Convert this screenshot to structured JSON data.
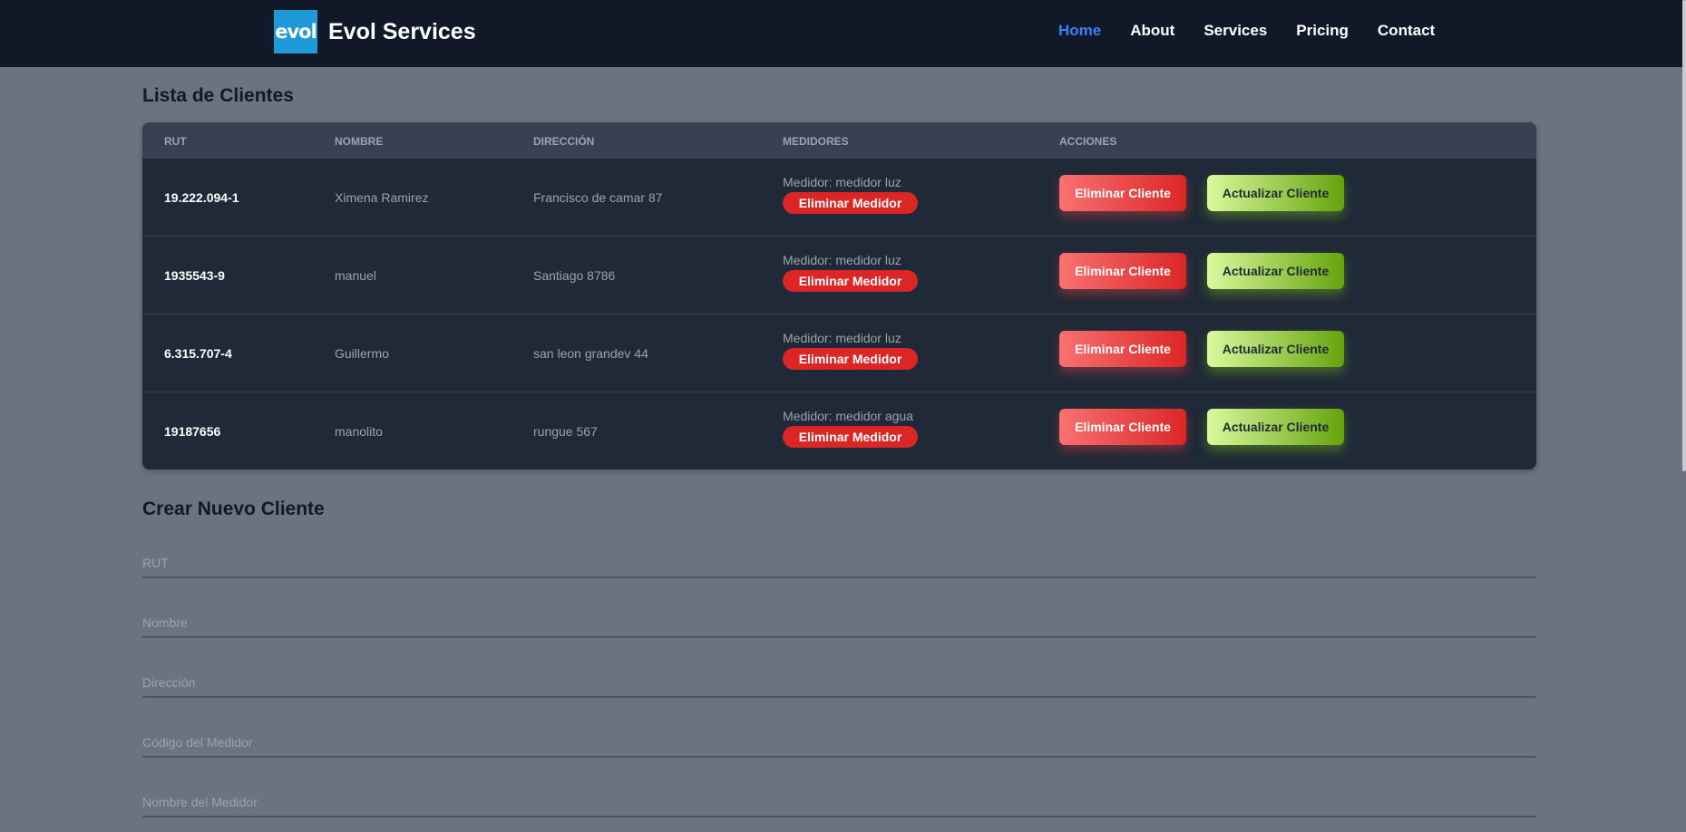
{
  "navbar": {
    "logo_text": "evol",
    "brand": "Evol Services",
    "links": [
      {
        "label": "Home",
        "active": true
      },
      {
        "label": "About"
      },
      {
        "label": "Services"
      },
      {
        "label": "Pricing"
      },
      {
        "label": "Contact"
      }
    ]
  },
  "clients": {
    "title": "Lista de Clientes",
    "headers": [
      "RUT",
      "NOMBRE",
      "DIRECCIÓN",
      "MEDIDORES",
      "ACCIONES"
    ],
    "rows": [
      {
        "rut": "19.222.094-1",
        "nombre": "Ximena Ramirez",
        "direccion": "Francisco de camar 87",
        "medidor": "Medidor: medidor luz"
      },
      {
        "rut": "1935543-9",
        "nombre": "manuel",
        "direccion": "Santiago 8786",
        "medidor": "Medidor: medidor luz"
      },
      {
        "rut": "6.315.707-4",
        "nombre": "Guillermo",
        "direccion": "san leon grandev 44",
        "medidor": "Medidor: medidor luz"
      },
      {
        "rut": "19187656",
        "nombre": "manolito",
        "direccion": "rungue 567",
        "medidor": "Medidor: medidor agua"
      }
    ],
    "btn_eliminar_medidor": "Eliminar Medidor",
    "btn_eliminar_cliente": "Eliminar Cliente",
    "btn_actualizar_cliente": "Actualizar Cliente"
  },
  "form": {
    "title": "Crear Nuevo Cliente",
    "rut_placeholder": "RUT",
    "nombre_placeholder": "Nombre",
    "direccion_placeholder": "Dirección",
    "codigo_medidor_placeholder": "Código del Medidor",
    "nombre_medidor_placeholder": "Nombre del Medidor"
  },
  "colors": {
    "navbar_bg": "#111827",
    "page_bg": "#6b7280",
    "table_bg": "#1f2937",
    "accent": "#3b82f6",
    "danger": "#dc2626",
    "success": "#84cc16"
  }
}
